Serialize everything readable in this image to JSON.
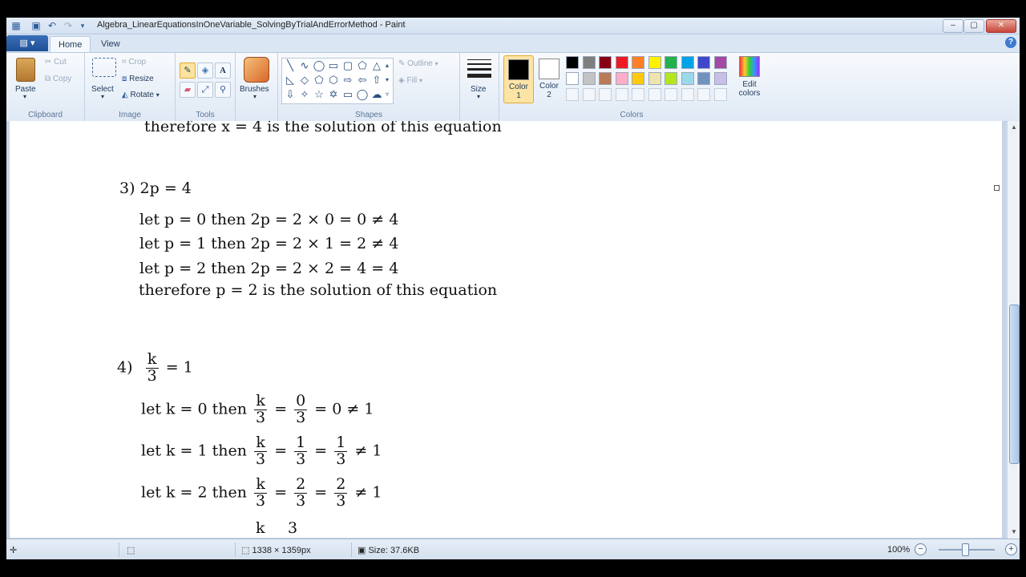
{
  "window": {
    "title": "Algebra_LinearEquationsInOneVariable_SolvingByTrialAndErrorMethod - Paint",
    "minimize": "–",
    "maximize": "▢",
    "close": "✕"
  },
  "tabs": {
    "home": "Home",
    "view": "View"
  },
  "ribbon": {
    "clipboard": {
      "label": "Clipboard",
      "paste": "Paste",
      "cut": "Cut",
      "copy": "Copy"
    },
    "image": {
      "label": "Image",
      "select": "Select",
      "crop": "Crop",
      "resize": "Resize",
      "rotate": "Rotate"
    },
    "tools": {
      "label": "Tools"
    },
    "brushes": {
      "label": "Brushes"
    },
    "shapes": {
      "label": "Shapes",
      "outline": "Outline",
      "fill": "Fill"
    },
    "size": {
      "label": "Size"
    },
    "colors": {
      "label": "Colors",
      "color1": "Color 1",
      "color1_a": "Color",
      "color1_b": "1",
      "color2_a": "Color",
      "color2_b": "2",
      "edit_a": "Edit",
      "edit_b": "colors",
      "palette_row1": [
        "#000000",
        "#7f7f7f",
        "#880015",
        "#ed1c24",
        "#ff7f27",
        "#fff200",
        "#22b14c",
        "#00a2e8",
        "#3f48cc",
        "#a349a4"
      ],
      "palette_row2": [
        "#ffffff",
        "#c3c3c3",
        "#b97a57",
        "#ffaec9",
        "#ffc90e",
        "#efe4b0",
        "#b5e61d",
        "#99d9ea",
        "#7092be",
        "#c8bfe7"
      ],
      "primary": "#000000",
      "secondary": "#ffffff"
    }
  },
  "document": {
    "line0": "therefore x = 4 is the solution of this equation",
    "q3": {
      "heading": "3)  2p = 4",
      "l1": "let p = 0   then 2p = 2 × 0 = 0 ≠ 4",
      "l2": "let p = 1   then 2p = 2 × 1 = 2 ≠ 4",
      "l3": "let p = 2   then 2p = 2 × 2 = 4 = 4",
      "conclusion": "therefore p = 2 is the solution of this equation"
    },
    "q4": {
      "num": "4)",
      "k": "k",
      "three": "3",
      "eq1": "= 1",
      "r1": {
        "let": "let k = 0   then",
        "n2": "0",
        "res": "= 0 ≠ 1"
      },
      "r2": {
        "let": "let k = 1   then",
        "n2": "1",
        "n3": "1",
        "res": "≠ 1"
      },
      "r3": {
        "let": "let k = 2   then",
        "n2": "2",
        "n3": "2",
        "res": "≠ 1"
      },
      "r4_partial": {
        "k": "k",
        "n2": "3"
      }
    },
    "eq": "="
  },
  "status": {
    "dimensions": "1338 × 1359px",
    "size": "Size: 37.6KB",
    "zoom": "100%"
  }
}
